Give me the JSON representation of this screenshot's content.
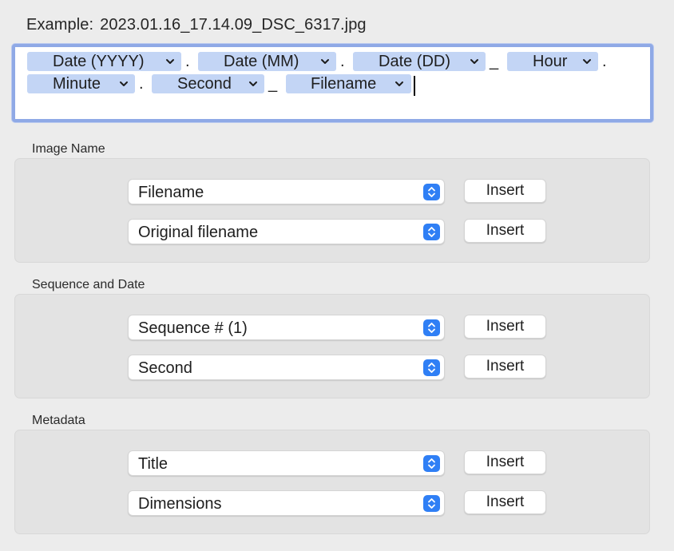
{
  "example": {
    "prefix": "Example:",
    "value": "2023.01.16_17.14.09_DSC_6317.jpg"
  },
  "token_field": {
    "tokens": [
      {
        "label": "Date (YYYY)"
      },
      {
        "label": "Date (MM)"
      },
      {
        "label": "Date (DD)"
      },
      {
        "label": "Hour"
      },
      {
        "label": "Minute"
      },
      {
        "label": "Second"
      },
      {
        "label": "Filename"
      }
    ],
    "separators": [
      ".",
      ".",
      "_",
      ".",
      ".",
      "_"
    ]
  },
  "sections": [
    {
      "title": "Image Name",
      "rows": [
        {
          "selected": "Filename",
          "button": "Insert"
        },
        {
          "selected": "Original filename",
          "button": "Insert"
        }
      ]
    },
    {
      "title": "Sequence and Date",
      "rows": [
        {
          "selected": "Sequence # (1)",
          "button": "Insert"
        },
        {
          "selected": "Second",
          "button": "Insert"
        }
      ]
    },
    {
      "title": "Metadata",
      "rows": [
        {
          "selected": "Title",
          "button": "Insert"
        },
        {
          "selected": "Dimensions",
          "button": "Insert"
        }
      ]
    }
  ],
  "icons": {
    "token_menu": "chevron-down-icon",
    "popup_stepper": "up-down-stepper-icon"
  },
  "colors": {
    "token_bg": "#c3d5f5",
    "focus_ring": "#8fa9e6",
    "stepper_accent": "#2f7ff5",
    "window_bg": "#ececec"
  }
}
